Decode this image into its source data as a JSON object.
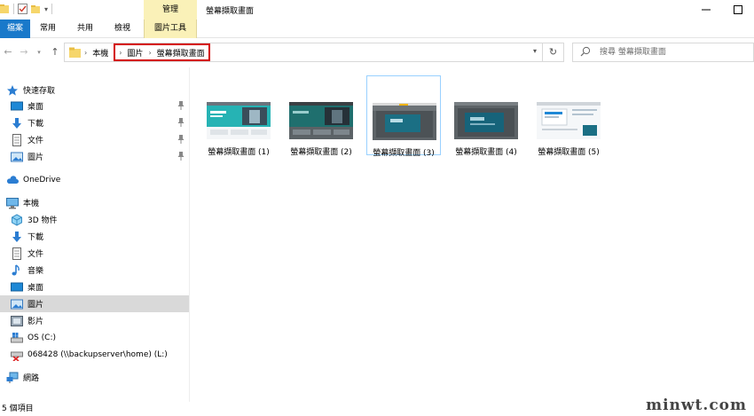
{
  "window": {
    "title": "螢幕擷取畫面",
    "context_tab_header": "管理"
  },
  "ribbon": {
    "tabs": [
      "檔案",
      "常用",
      "共用",
      "檢視",
      "圖片工具"
    ]
  },
  "address": {
    "crumbs": [
      "本機",
      "圖片",
      "螢幕擷取畫面"
    ],
    "search_placeholder": "搜尋 螢幕擷取畫面"
  },
  "sidebar": {
    "quick_access": "快速存取",
    "quick_items": [
      "桌面",
      "下載",
      "文件",
      "圖片"
    ],
    "onedrive": "OneDrive",
    "this_pc": "本機",
    "pc_items": [
      "3D 物件",
      "下載",
      "文件",
      "音樂",
      "桌面",
      "圖片",
      "影片",
      "OS (C:)",
      "068428 (\\\\backupserver\\home) (L:)"
    ],
    "network": "網路",
    "selected": "圖片"
  },
  "files": [
    {
      "name": "螢幕擷取畫面 (1)"
    },
    {
      "name": "螢幕擷取畫面 (2)"
    },
    {
      "name": "螢幕擷取畫面 (3)",
      "selected": true
    },
    {
      "name": "螢幕擷取畫面 (4)"
    },
    {
      "name": "螢幕擷取畫面 (5)"
    }
  ],
  "status": {
    "item_count": "5 個項目"
  },
  "watermark": "minwt.com",
  "colors": {
    "file_tab": "#1979ca",
    "context_tab": "#faf1b8",
    "highlight_box": "#d40000",
    "selection": "#d9d9d9"
  }
}
